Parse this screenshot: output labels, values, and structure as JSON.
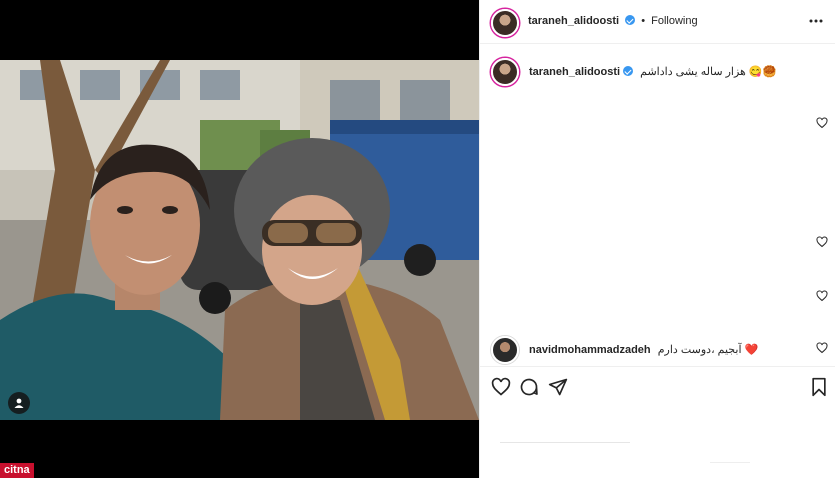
{
  "post": {
    "author": "taraneh_alidoosti",
    "follow_separator": "•",
    "follow_status": "Following",
    "caption": "هزار ساله یشی داداشم 😋🥮"
  },
  "comments": [
    {
      "username": "navidmohammadzadeh",
      "text": "آبجیم ،دوست دارم ❤️"
    }
  ],
  "watermark": "citna",
  "icons": {
    "more": "more-options-icon",
    "like": "heart-icon",
    "comment": "comment-icon",
    "share": "share-icon",
    "save": "bookmark-icon",
    "verified": "verified-badge-icon",
    "tag": "user-tag-icon"
  },
  "colors": {
    "verified": "#3897f0",
    "story_ring": "#d6249f",
    "watermark_bg": "#c8102e"
  }
}
